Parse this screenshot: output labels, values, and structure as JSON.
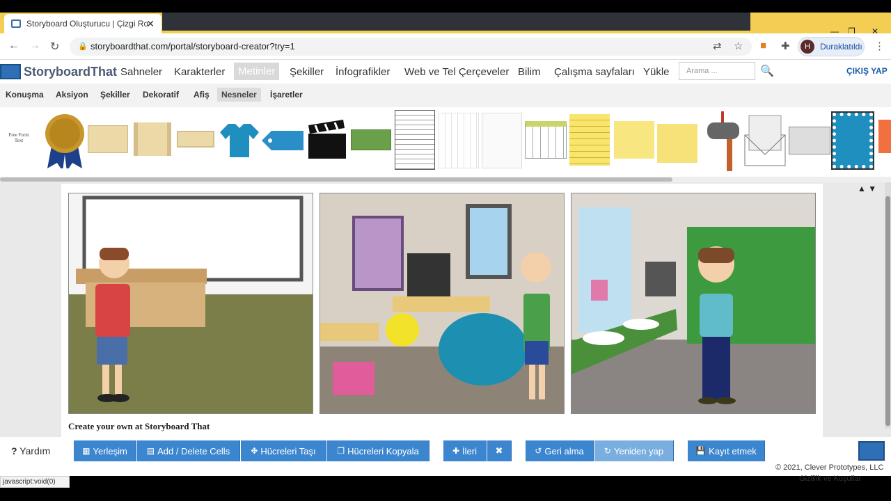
{
  "browser": {
    "tab_title": "Storyboard Oluşturucu | Çizgi Ro",
    "url": "storyboardthat.com/portal/storyboard-creator?try=1",
    "profile_initial": "H",
    "profile_label": "Duraklatıldı"
  },
  "site": {
    "logo_text": "StoryboardThat",
    "menu": [
      "Sahneler",
      "Karakterler",
      "Metinler",
      "Şekiller",
      "İnfografikler",
      "Web ve Tel Çerçeveler",
      "Bilim",
      "Çalışma sayfaları",
      "Yükle"
    ],
    "active_menu": "Metinler",
    "search_placeholder": "Arama ...",
    "logout": "ÇIKIŞ YAP"
  },
  "subnav": {
    "items": [
      "Konuşma",
      "Aksiyon",
      "Şekiller",
      "Dekoratif",
      "Afiş",
      "Nesneler",
      "İşaretler"
    ],
    "selected": "Nesneler"
  },
  "palette": {
    "free_form_text": "Free Form Text",
    "items": [
      "ribbon-medal",
      "parchment-banner",
      "scroll",
      "paper-scroll",
      "t-shirt",
      "tag",
      "clapperboard",
      "green-sign",
      "notepad",
      "grid-paper",
      "blank-paper",
      "calendar",
      "legal-pad",
      "sticky-note-pin",
      "sticky-note-tape",
      "mailbox",
      "envelope",
      "cash-register",
      "stamp",
      "orange-card"
    ]
  },
  "storyboard": {
    "cells": [
      "classroom-boy",
      "classroom-girl",
      "bathroom-boy"
    ],
    "credit": "Create your own at Storyboard That"
  },
  "bottom": {
    "help": "Yardım",
    "buttons": [
      "Yerleşim",
      "Add / Delete Cells",
      "Hücreleri Taşı",
      "Hücreleri Kopyala",
      "İleri",
      "Geri alma",
      "Yeniden yap",
      "Kayıt etmek"
    ],
    "copyright": "© 2021, Clever Prototypes, LLC",
    "privacy": "Gizlilik ve Koşullar"
  },
  "status_bar": "javascript:void(0)",
  "colors": {
    "accent": "#3b86cf",
    "tabbar": "#f4ce52"
  }
}
